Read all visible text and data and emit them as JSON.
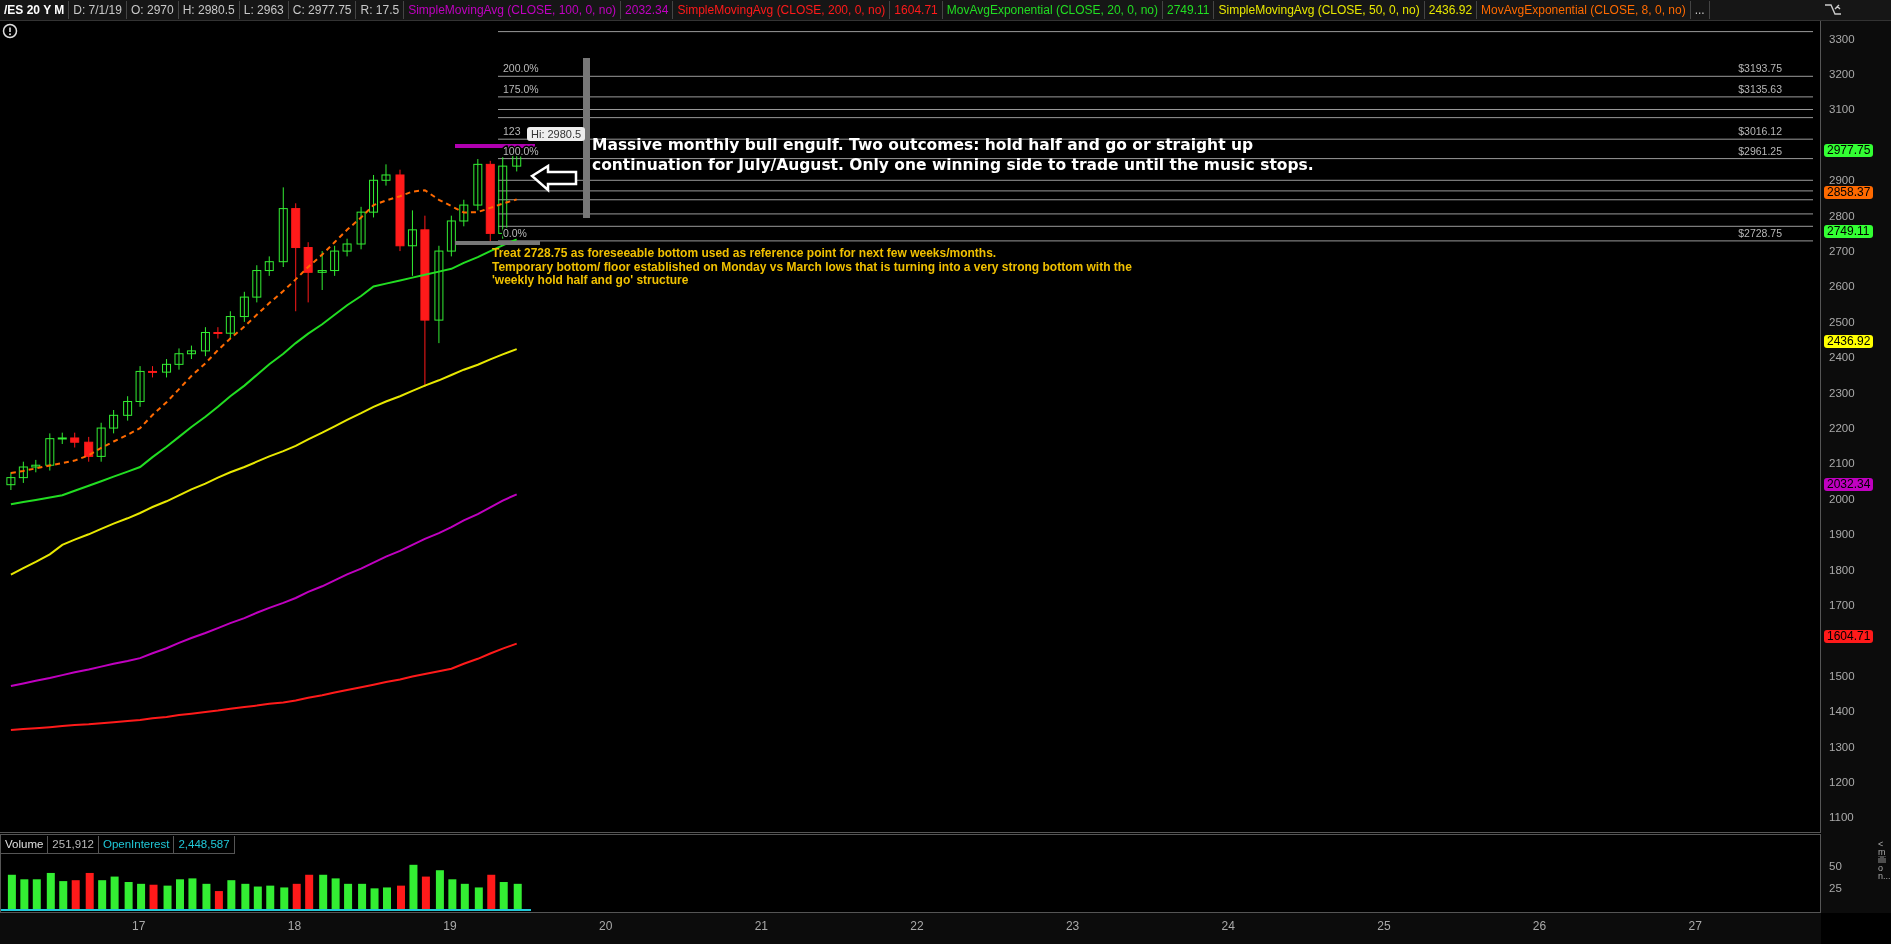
{
  "header": {
    "items": [
      {
        "text": "/ES 20 Y M",
        "kind": "symbol"
      },
      {
        "text": "D: 7/1/19",
        "kind": "stat"
      },
      {
        "text": "O: 2970",
        "kind": "stat"
      },
      {
        "text": "H: 2980.5",
        "kind": "stat"
      },
      {
        "text": "L: 2963",
        "kind": "stat"
      },
      {
        "text": "C: 2977.75",
        "kind": "stat"
      },
      {
        "text": "R: 17.5",
        "kind": "stat"
      },
      {
        "text": "SimpleMovingAvg (CLOSE, 100, 0, no)",
        "kind": "study",
        "color": "#c000c0"
      },
      {
        "text": "2032.34",
        "kind": "study",
        "color": "#c000c0"
      },
      {
        "text": "SimpleMovingAvg (CLOSE, 200, 0, no)",
        "kind": "study",
        "color": "#ff1a1a"
      },
      {
        "text": "1604.71",
        "kind": "study",
        "color": "#ff1a1a"
      },
      {
        "text": "MovAvgExponential (CLOSE, 20, 0, no)",
        "kind": "study",
        "color": "#22dd22"
      },
      {
        "text": "2749.11",
        "kind": "study",
        "color": "#22dd22"
      },
      {
        "text": "SimpleMovingAvg (CLOSE, 50, 0, no)",
        "kind": "study",
        "color": "#e8e800"
      },
      {
        "text": "2436.92",
        "kind": "study",
        "color": "#e8e800"
      },
      {
        "text": "MovAvgExponential (CLOSE, 8, 0, no)",
        "kind": "study",
        "color": "#ff6a00"
      },
      {
        "text": "...",
        "kind": "more"
      }
    ]
  },
  "price_chart": {
    "hi_label": "Hi: 2980.5",
    "fib_levels": [
      {
        "label": "200.0%",
        "price": "$3193.75"
      },
      {
        "label": "175.0%",
        "price": "$3135.63"
      },
      {
        "label": "123",
        "price": "$3016.12"
      },
      {
        "label": "100.0%",
        "price": "$2961.25"
      },
      {
        "label": "0.0%",
        "price": "$2728.75"
      }
    ],
    "price_tags": [
      {
        "text": "2977.75",
        "color": "#33ff33"
      },
      {
        "text": "2858.37",
        "color": "#ff6a00"
      },
      {
        "text": "2749.11",
        "color": "#33ff33"
      },
      {
        "text": "2436.92",
        "color": "#ffff00"
      },
      {
        "text": "2032.34",
        "color": "#c000c0"
      },
      {
        "text": "1604.71",
        "color": "#ff1a1a"
      }
    ],
    "notes": [
      {
        "kind": "headline",
        "lines": [
          "Massive monthly bull engulf. Two outcomes: hold half and go or straight up",
          "continuation for July/August. Only one winning side to trade until the music stops."
        ]
      },
      {
        "kind": "comment",
        "lines": [
          "Treat 2728.75 as foreseeable bottom used as reference point for next few weeks/months.",
          "Temporary bottom/ floor established on Monday vs March lows that is turning into a very strong bottom with the",
          "'weekly hold half and go' structure"
        ]
      }
    ],
    "chart_data": {
      "type": "candlestick",
      "grid": true,
      "xlim": [
        16.1,
        27.8
      ],
      "ylim": [
        1056,
        3350
      ],
      "xticks": [
        {
          "value": 17,
          "label": "17"
        },
        {
          "value": 18,
          "label": "18"
        },
        {
          "value": 19,
          "label": "19"
        },
        {
          "value": 20,
          "label": "20"
        },
        {
          "value": 21,
          "label": "21"
        },
        {
          "value": 22,
          "label": "22"
        },
        {
          "value": 23,
          "label": "23"
        },
        {
          "value": 24,
          "label": "24"
        },
        {
          "value": 25,
          "label": "25"
        },
        {
          "value": 26,
          "label": "26"
        },
        {
          "value": 27,
          "label": "27"
        }
      ],
      "yticks": [
        1100,
        1200,
        1300,
        1400,
        1500,
        1700,
        1800,
        1900,
        2000,
        2100,
        2200,
        2300,
        2400,
        2500,
        2600,
        2700,
        2800,
        2900,
        3100,
        3200,
        3300
      ],
      "x": [
        16.17,
        16.25,
        16.33,
        16.42,
        16.5,
        16.58,
        16.67,
        16.75,
        16.83,
        16.92,
        17,
        17.08,
        17.17,
        17.25,
        17.33,
        17.42,
        17.5,
        17.58,
        17.67,
        17.75,
        17.83,
        17.92,
        18,
        18.08,
        18.17,
        18.25,
        18.33,
        18.42,
        18.5,
        18.58,
        18.67,
        18.75,
        18.83,
        18.92,
        19,
        19.08,
        19.17,
        19.25,
        19.33,
        19.42
      ],
      "ohlc": [
        [
          2040,
          2075,
          2025,
          2060
        ],
        [
          2060,
          2105,
          2045,
          2090
        ],
        [
          2090,
          2110,
          2075,
          2095
        ],
        [
          2095,
          2185,
          2080,
          2170
        ],
        [
          2170,
          2187,
          2155,
          2172
        ],
        [
          2172,
          2187,
          2145,
          2160
        ],
        [
          2160,
          2175,
          2105,
          2120
        ],
        [
          2120,
          2215,
          2105,
          2200
        ],
        [
          2200,
          2251,
          2185,
          2236
        ],
        [
          2236,
          2290,
          2221,
          2275
        ],
        [
          2275,
          2375,
          2260,
          2360
        ],
        [
          2360,
          2375,
          2343,
          2358
        ],
        [
          2358,
          2395,
          2343,
          2380
        ],
        [
          2380,
          2425,
          2365,
          2410
        ],
        [
          2410,
          2433,
          2395,
          2418
        ],
        [
          2418,
          2485,
          2403,
          2470
        ],
        [
          2470,
          2485,
          2453,
          2468
        ],
        [
          2468,
          2530,
          2453,
          2515
        ],
        [
          2515,
          2585,
          2500,
          2570
        ],
        [
          2570,
          2660,
          2555,
          2645
        ],
        [
          2645,
          2685,
          2630,
          2670
        ],
        [
          2670,
          2880,
          2655,
          2820
        ],
        [
          2820,
          2835,
          2530,
          2710
        ],
        [
          2710,
          2725,
          2555,
          2640
        ],
        [
          2640,
          2700,
          2590,
          2645
        ],
        [
          2645,
          2715,
          2630,
          2700
        ],
        [
          2700,
          2735,
          2685,
          2720
        ],
        [
          2720,
          2825,
          2705,
          2810
        ],
        [
          2810,
          2915,
          2795,
          2900
        ],
        [
          2900,
          2945,
          2885,
          2915
        ],
        [
          2915,
          2930,
          2700,
          2715
        ],
        [
          2715,
          2815,
          2630,
          2760
        ],
        [
          2760,
          2800,
          2316,
          2505
        ],
        [
          2505,
          2715,
          2440,
          2700
        ],
        [
          2700,
          2800,
          2685,
          2785
        ],
        [
          2785,
          2845,
          2770,
          2830
        ],
        [
          2830,
          2960,
          2815,
          2945
        ],
        [
          2945,
          2955,
          2728,
          2750
        ],
        [
          2750,
          2965,
          2735,
          2940
        ],
        [
          2940,
          2981,
          2925,
          2978
        ]
      ],
      "series": [
        {
          "type": "line",
          "color": "#ff1a1a",
          "line_style": "solid",
          "values": [
            1347,
            1350,
            1352,
            1355,
            1358,
            1361,
            1363,
            1366,
            1369,
            1372,
            1375,
            1380,
            1384,
            1389,
            1393,
            1398,
            1402,
            1407,
            1412,
            1416,
            1421,
            1425,
            1430,
            1438,
            1445,
            1453,
            1460,
            1468,
            1475,
            1483,
            1490,
            1498,
            1505,
            1513,
            1520,
            1534,
            1548,
            1563,
            1577,
            1591
          ]
        },
        {
          "type": "line",
          "color": "#c000c0",
          "line_style": "solid",
          "values": [
            1471,
            1478,
            1486,
            1494,
            1502,
            1510,
            1518,
            1526,
            1534,
            1542,
            1550,
            1564,
            1578,
            1593,
            1607,
            1621,
            1635,
            1649,
            1663,
            1678,
            1692,
            1706,
            1720,
            1737,
            1753,
            1770,
            1787,
            1803,
            1820,
            1837,
            1853,
            1870,
            1887,
            1903,
            1920,
            1939,
            1957,
            1976,
            1995,
            2013
          ]
        },
        {
          "type": "line",
          "color": "#e8e800",
          "line_style": "solid",
          "values": [
            1786,
            1804,
            1822,
            1843,
            1870,
            1885,
            1900,
            1915,
            1930,
            1945,
            1960,
            1977,
            1993,
            2010,
            2027,
            2043,
            2060,
            2075,
            2090,
            2105,
            2120,
            2135,
            2150,
            2168,
            2187,
            2205,
            2223,
            2242,
            2260,
            2275,
            2290,
            2305,
            2320,
            2335,
            2350,
            2365,
            2379,
            2394,
            2408,
            2423
          ]
        },
        {
          "type": "line",
          "color": "#22dd22",
          "line_style": "solid",
          "values": [
            1985,
            1991,
            1997,
            2004,
            2010,
            2023,
            2037,
            2050,
            2063,
            2077,
            2090,
            2118,
            2147,
            2175,
            2203,
            2232,
            2260,
            2290,
            2320,
            2350,
            2380,
            2410,
            2440,
            2467,
            2493,
            2520,
            2547,
            2573,
            2600,
            2608,
            2617,
            2625,
            2633,
            2642,
            2650,
            2667,
            2683,
            2700,
            2716,
            2733
          ]
        },
        {
          "type": "line",
          "color": "#ff6a00",
          "line_style": "dashed",
          "values": [
            2073,
            2079,
            2086,
            2094,
            2101,
            2108,
            2123,
            2144,
            2162,
            2181,
            2200,
            2237,
            2273,
            2310,
            2347,
            2383,
            2420,
            2453,
            2487,
            2520,
            2553,
            2587,
            2620,
            2655,
            2690,
            2725,
            2760,
            2795,
            2830,
            2843,
            2855,
            2868,
            2872,
            2845,
            2827,
            2809,
            2810,
            2822,
            2834,
            2846
          ]
        }
      ]
    }
  },
  "volume_panel": {
    "labels": [
      {
        "text": "Volume",
        "kind": "name"
      },
      {
        "text": "251,912",
        "kind": "value"
      },
      {
        "text": "OpenInterest",
        "kind": "study"
      },
      {
        "text": "2,448,587",
        "kind": "study"
      }
    ],
    "unit_label": "<million...",
    "chart_data": {
      "type": "bar",
      "xlim": [
        16.1,
        27.8
      ],
      "ylim": [
        0,
        85
      ],
      "x": [
        16.17,
        16.25,
        16.33,
        16.42,
        16.5,
        16.58,
        16.67,
        16.75,
        16.83,
        16.92,
        17,
        17.08,
        17.17,
        17.25,
        17.33,
        17.42,
        17.5,
        17.58,
        17.67,
        17.75,
        17.83,
        17.92,
        18,
        18.08,
        18.17,
        18.25,
        18.33,
        18.42,
        18.5,
        18.58,
        18.67,
        18.75,
        18.83,
        18.92,
        19,
        19.08,
        19.17,
        19.25,
        19.33,
        19.42
      ],
      "yticks": [
        25,
        50
      ],
      "values": [
        40,
        35,
        35,
        42,
        33,
        34,
        42,
        34,
        38,
        32,
        30,
        29,
        28,
        35,
        36,
        30,
        22,
        34,
        30,
        27,
        28,
        26,
        30,
        40,
        40,
        36,
        30,
        30,
        25,
        26,
        28,
        51,
        38,
        45,
        35,
        30,
        26,
        40,
        32,
        30
      ]
    }
  }
}
